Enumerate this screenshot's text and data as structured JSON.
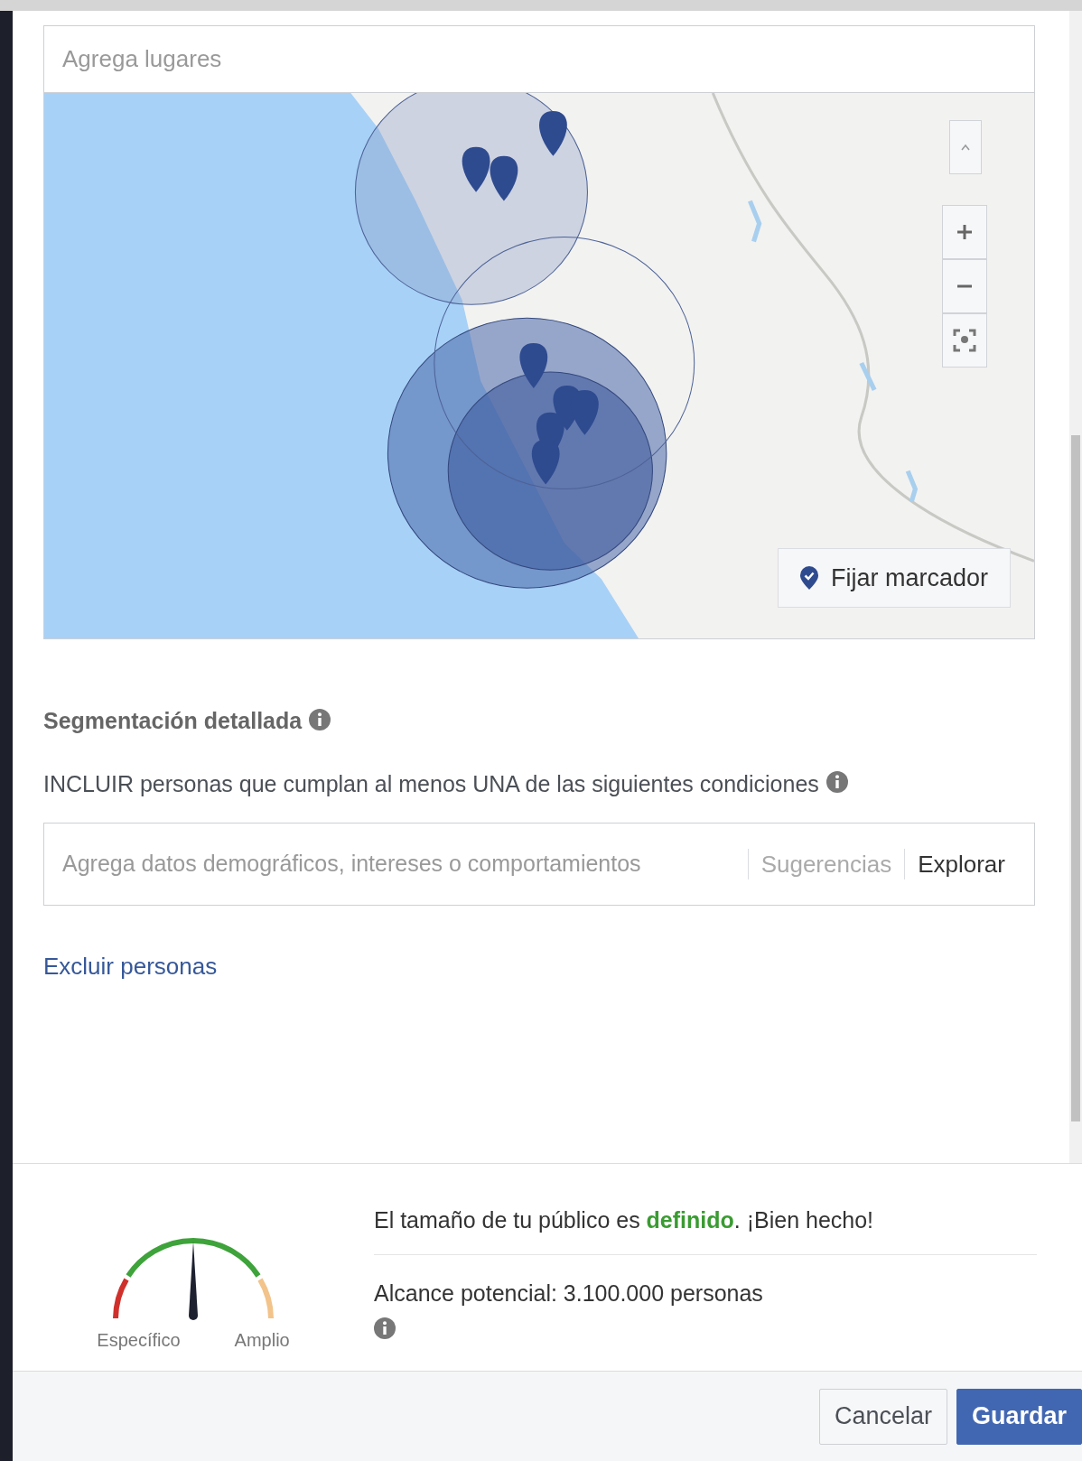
{
  "location_search": {
    "placeholder": "Agrega lugares"
  },
  "map": {
    "kind": "picture",
    "drop_pin_button": "Fijar marcador"
  },
  "detailed_targeting": {
    "title": "Segmentación detallada",
    "include_label": "INCLUIR personas que cumplan al menos UNA de las siguientes condiciones",
    "field": {
      "placeholder": "Agrega datos demográficos, intereses o comportamientos"
    },
    "suggestions": {
      "label": "Sugerencias",
      "disabled": true
    },
    "browse": {
      "label": "Explorar",
      "disabled": false
    },
    "exclude_link": "Excluir personas"
  },
  "audience": {
    "gauge": {
      "low_label": "Específico",
      "high_label": "Amplio"
    },
    "summary": "El tamaño de tu público es **definido**. ¡Bien hecho!",
    "reach": "Alcance potencial: 3.100.000 personas"
  },
  "buttons": [
    {
      "label": "Cancelar",
      "kind": "secondary"
    },
    {
      "label": "Guardar",
      "kind": "primary"
    }
  ]
}
